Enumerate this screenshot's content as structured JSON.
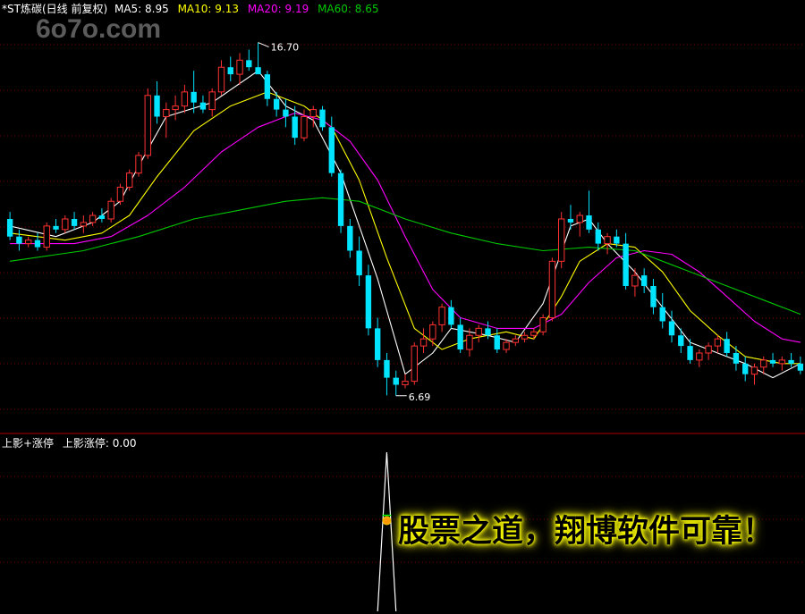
{
  "header": {
    "title": "*ST炼碳(日线 前复权)",
    "ma5": "MA5: 8.95",
    "ma10": "MA10: 9.13",
    "ma20": "MA20: 9.19",
    "ma60": "MA60: 8.65"
  },
  "watermark": "6o7o.com",
  "indicator_header": {
    "name": "上影+涨停",
    "value_label": "上影涨停: 0.00"
  },
  "banner": "股票之道，翔博软件可靠！",
  "colors": {
    "background": "#000000",
    "up": "#ff3232",
    "down": "#00e4ff",
    "ma5": "#ffffff",
    "ma10": "#ffff00",
    "ma20": "#ff00ff",
    "ma60": "#00c800",
    "grid": "#7a0000",
    "banner_text": "#000000",
    "banner_glow": "#ffff00"
  },
  "chart_data": [
    {
      "type": "candlestick",
      "title": "*ST炼碳(日线 前复权)",
      "annotations": [
        {
          "text": "16.70",
          "kind": "high"
        },
        {
          "text": "6.69",
          "kind": "low"
        }
      ],
      "ylim": [
        6.0,
        17.5
      ],
      "candles": [
        [
          11.7,
          11.9,
          11.1,
          11.2
        ],
        [
          11.2,
          11.4,
          10.8,
          11.0
        ],
        [
          11.0,
          11.2,
          10.9,
          11.1
        ],
        [
          11.1,
          11.3,
          10.8,
          10.9
        ],
        [
          10.9,
          11.6,
          10.8,
          11.5
        ],
        [
          11.5,
          11.7,
          11.3,
          11.4
        ],
        [
          11.4,
          11.8,
          11.3,
          11.7
        ],
        [
          11.7,
          11.9,
          11.4,
          11.5
        ],
        [
          11.5,
          11.8,
          11.3,
          11.6
        ],
        [
          11.6,
          11.9,
          11.5,
          11.8
        ],
        [
          11.8,
          12.0,
          11.6,
          11.7
        ],
        [
          11.7,
          12.3,
          11.6,
          12.2
        ],
        [
          12.2,
          12.7,
          12.1,
          12.6
        ],
        [
          12.6,
          13.1,
          12.5,
          13.0
        ],
        [
          13.0,
          13.6,
          12.9,
          13.5
        ],
        [
          13.5,
          15.4,
          13.4,
          15.2
        ],
        [
          15.2,
          15.6,
          14.4,
          14.6
        ],
        [
          14.6,
          15.0,
          14.0,
          14.8
        ],
        [
          14.8,
          15.2,
          14.5,
          14.9
        ],
        [
          14.9,
          15.5,
          14.7,
          15.3
        ],
        [
          15.3,
          15.9,
          14.7,
          15.0
        ],
        [
          15.0,
          15.2,
          14.7,
          14.8
        ],
        [
          14.8,
          15.4,
          14.6,
          15.3
        ],
        [
          15.3,
          16.2,
          15.2,
          16.0
        ],
        [
          16.0,
          16.3,
          15.6,
          15.8
        ],
        [
          15.8,
          16.4,
          15.5,
          16.2
        ],
        [
          16.2,
          16.5,
          15.9,
          16.0
        ],
        [
          16.0,
          16.7,
          15.9,
          15.8
        ],
        [
          15.8,
          15.9,
          14.9,
          15.1
        ],
        [
          15.1,
          15.3,
          14.6,
          14.8
        ],
        [
          14.8,
          15.1,
          14.3,
          14.6
        ],
        [
          14.6,
          14.9,
          13.8,
          14.0
        ],
        [
          14.0,
          14.8,
          13.9,
          14.6
        ],
        [
          14.6,
          14.9,
          14.3,
          14.8
        ],
        [
          14.8,
          14.9,
          14.2,
          14.3
        ],
        [
          14.3,
          14.6,
          12.9,
          13.0
        ],
        [
          13.0,
          13.1,
          11.3,
          11.5
        ],
        [
          11.5,
          11.7,
          10.6,
          10.8
        ],
        [
          10.8,
          11.2,
          9.8,
          10.1
        ],
        [
          10.1,
          10.4,
          8.4,
          8.6
        ],
        [
          8.6,
          8.9,
          7.5,
          7.7
        ],
        [
          7.7,
          7.9,
          6.7,
          7.2
        ],
        [
          7.2,
          7.4,
          6.69,
          7.0
        ],
        [
          7.0,
          7.3,
          6.9,
          7.1
        ],
        [
          7.1,
          8.2,
          7.0,
          8.1
        ],
        [
          8.1,
          8.6,
          7.9,
          8.3
        ],
        [
          8.3,
          8.8,
          8.1,
          8.7
        ],
        [
          8.7,
          9.3,
          8.5,
          9.2
        ],
        [
          9.2,
          9.4,
          8.6,
          8.7
        ],
        [
          8.7,
          8.9,
          7.9,
          8.0
        ],
        [
          8.0,
          8.6,
          7.8,
          8.4
        ],
        [
          8.4,
          8.7,
          8.2,
          8.6
        ],
        [
          8.6,
          8.8,
          8.3,
          8.4
        ],
        [
          8.4,
          8.6,
          7.9,
          8.0
        ],
        [
          8.0,
          8.3,
          7.9,
          8.2
        ],
        [
          8.2,
          8.4,
          8.1,
          8.3
        ],
        [
          8.3,
          8.5,
          8.2,
          8.4
        ],
        [
          8.4,
          8.6,
          8.3,
          8.5
        ],
        [
          8.5,
          9.0,
          8.4,
          8.9
        ],
        [
          8.9,
          10.6,
          8.8,
          10.5
        ],
        [
          10.5,
          11.9,
          10.3,
          11.7
        ],
        [
          11.7,
          12.1,
          11.4,
          11.6
        ],
        [
          11.6,
          11.9,
          11.2,
          11.8
        ],
        [
          11.8,
          12.5,
          11.3,
          11.4
        ],
        [
          11.4,
          11.6,
          10.8,
          11.0
        ],
        [
          11.0,
          11.3,
          10.7,
          11.2
        ],
        [
          11.2,
          11.4,
          10.9,
          11.0
        ],
        [
          11.0,
          11.3,
          9.7,
          9.8
        ],
        [
          9.8,
          10.3,
          9.5,
          10.1
        ],
        [
          10.1,
          10.3,
          9.6,
          9.8
        ],
        [
          9.8,
          10.0,
          9.0,
          9.2
        ],
        [
          9.2,
          9.6,
          8.6,
          8.8
        ],
        [
          8.8,
          9.1,
          8.2,
          8.4
        ],
        [
          8.4,
          8.6,
          7.9,
          8.1
        ],
        [
          8.1,
          8.3,
          7.6,
          7.7
        ],
        [
          7.7,
          8.0,
          7.5,
          7.9
        ],
        [
          7.9,
          8.2,
          7.7,
          8.1
        ],
        [
          8.1,
          8.4,
          7.9,
          8.3
        ],
        [
          8.3,
          8.5,
          7.8,
          7.9
        ],
        [
          7.9,
          8.1,
          7.4,
          7.6
        ],
        [
          7.6,
          7.8,
          7.1,
          7.3
        ],
        [
          7.3,
          7.6,
          7.0,
          7.5
        ],
        [
          7.5,
          7.8,
          7.3,
          7.7
        ],
        [
          7.7,
          7.9,
          7.5,
          7.6
        ],
        [
          7.6,
          7.8,
          7.4,
          7.7
        ],
        [
          7.7,
          7.9,
          7.5,
          7.6
        ],
        [
          7.6,
          7.8,
          7.3,
          7.4
        ]
      ],
      "ma": {
        "MA5": [
          [
            0,
            11.5
          ],
          [
            5,
            11.2
          ],
          [
            9,
            11.6
          ],
          [
            12,
            12.2
          ],
          [
            14,
            13.2
          ],
          [
            17,
            14.6
          ],
          [
            22,
            15.0
          ],
          [
            27,
            15.9
          ],
          [
            30,
            14.9
          ],
          [
            33,
            14.5
          ],
          [
            36,
            13.0
          ],
          [
            40,
            10.0
          ],
          [
            43,
            7.3
          ],
          [
            46,
            7.9
          ],
          [
            48,
            8.6
          ],
          [
            52,
            8.4
          ],
          [
            55,
            8.2
          ],
          [
            58,
            9.3
          ],
          [
            61,
            11.5
          ],
          [
            63,
            11.7
          ],
          [
            65,
            11.0
          ],
          [
            68,
            10.2
          ],
          [
            71,
            9.2
          ],
          [
            74,
            8.2
          ],
          [
            77,
            7.9
          ],
          [
            80,
            7.6
          ],
          [
            83,
            7.2
          ],
          [
            86,
            7.6
          ]
        ],
        "MA10": [
          [
            0,
            11.3
          ],
          [
            6,
            11.1
          ],
          [
            10,
            11.3
          ],
          [
            13,
            11.8
          ],
          [
            16,
            12.9
          ],
          [
            20,
            14.2
          ],
          [
            24,
            14.9
          ],
          [
            28,
            15.3
          ],
          [
            32,
            14.9
          ],
          [
            35,
            14.3
          ],
          [
            38,
            12.8
          ],
          [
            41,
            10.6
          ],
          [
            44,
            8.6
          ],
          [
            47,
            8.0
          ],
          [
            50,
            8.3
          ],
          [
            54,
            8.5
          ],
          [
            57,
            8.3
          ],
          [
            60,
            9.5
          ],
          [
            62,
            10.5
          ],
          [
            65,
            11.0
          ],
          [
            68,
            10.9
          ],
          [
            71,
            10.2
          ],
          [
            74,
            9.1
          ],
          [
            77,
            8.4
          ],
          [
            80,
            7.8
          ],
          [
            84,
            7.6
          ],
          [
            86,
            7.6
          ]
        ],
        "MA20": [
          [
            0,
            11.0
          ],
          [
            7,
            11.0
          ],
          [
            11,
            11.2
          ],
          [
            15,
            11.8
          ],
          [
            19,
            12.6
          ],
          [
            23,
            13.6
          ],
          [
            27,
            14.3
          ],
          [
            31,
            14.7
          ],
          [
            34,
            14.5
          ],
          [
            37,
            13.9
          ],
          [
            40,
            12.8
          ],
          [
            43,
            11.2
          ],
          [
            46,
            9.7
          ],
          [
            49,
            8.9
          ],
          [
            53,
            8.6
          ],
          [
            57,
            8.6
          ],
          [
            60,
            9.0
          ],
          [
            63,
            9.9
          ],
          [
            66,
            10.6
          ],
          [
            69,
            10.8
          ],
          [
            72,
            10.7
          ],
          [
            75,
            10.2
          ],
          [
            78,
            9.5
          ],
          [
            81,
            8.8
          ],
          [
            84,
            8.3
          ],
          [
            86,
            8.2
          ]
        ],
        "MA60": [
          [
            0,
            10.5
          ],
          [
            8,
            10.8
          ],
          [
            14,
            11.2
          ],
          [
            20,
            11.7
          ],
          [
            26,
            12.0
          ],
          [
            30,
            12.2
          ],
          [
            34,
            12.3
          ],
          [
            38,
            12.2
          ],
          [
            43,
            11.7
          ],
          [
            48,
            11.3
          ],
          [
            53,
            11.0
          ],
          [
            58,
            10.8
          ],
          [
            63,
            10.9
          ],
          [
            68,
            10.8
          ],
          [
            73,
            10.3
          ],
          [
            78,
            9.8
          ],
          [
            83,
            9.3
          ],
          [
            86,
            9.0
          ]
        ]
      }
    },
    {
      "type": "line",
      "title": "上影+涨停",
      "series_name": "上影涨停",
      "values": [
        0,
        0,
        0,
        0,
        0,
        0,
        0,
        0,
        0,
        0,
        0,
        0,
        0,
        0,
        0,
        0,
        0,
        0,
        0,
        0,
        0,
        0,
        0,
        0,
        0,
        0,
        0,
        0,
        0,
        0,
        0,
        0,
        0,
        0,
        0,
        0,
        0,
        0,
        0,
        0,
        0,
        1,
        0,
        0,
        0,
        0,
        0,
        0,
        0,
        0,
        0,
        0,
        0,
        0,
        0,
        0,
        0,
        0,
        0,
        0,
        0,
        0,
        0,
        0,
        0,
        0,
        0,
        0,
        0,
        0,
        0,
        0,
        0,
        0,
        0,
        0,
        0,
        0,
        0,
        0,
        0,
        0,
        0,
        0,
        0,
        0,
        0
      ],
      "ylim": [
        0,
        1
      ]
    }
  ]
}
